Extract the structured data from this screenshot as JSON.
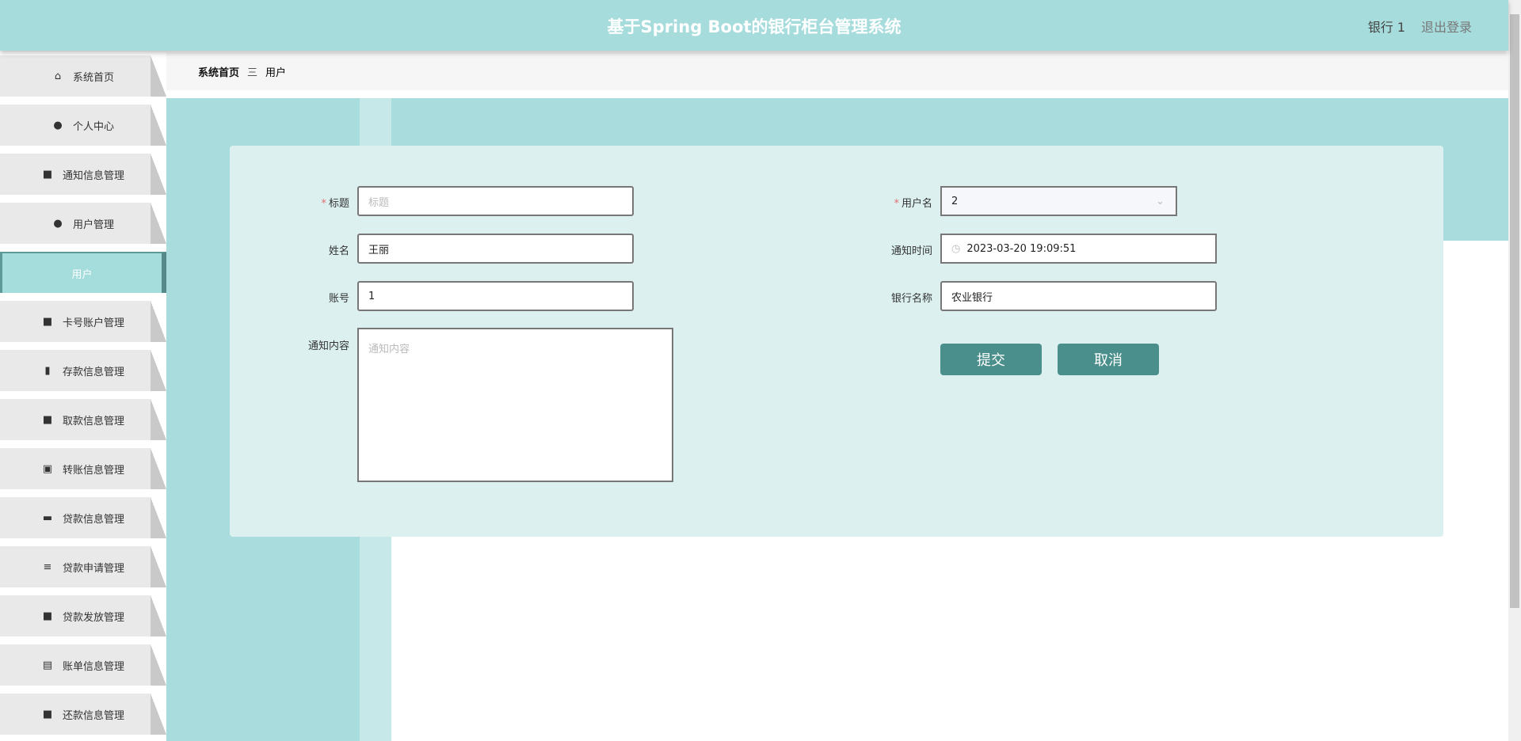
{
  "header": {
    "title": "基于Spring Boot的银行柜台管理系统",
    "user": "银行 1",
    "logout": "退出登录"
  },
  "sidebar": {
    "items": [
      {
        "label": "系统首页",
        "icon": "home-icon"
      },
      {
        "label": "个人中心",
        "icon": "user-icon"
      },
      {
        "label": "通知信息管理",
        "icon": "grid-icon"
      },
      {
        "label": "用户管理",
        "icon": "bulb-icon"
      },
      {
        "label": "用户",
        "icon": "",
        "active": true
      },
      {
        "label": "卡号账户管理",
        "icon": "grid-icon"
      },
      {
        "label": "存款信息管理",
        "icon": "bar-chart-icon"
      },
      {
        "label": "取款信息管理",
        "icon": "grid-icon"
      },
      {
        "label": "转账信息管理",
        "icon": "clipboard-x-icon"
      },
      {
        "label": "贷款信息管理",
        "icon": "briefcase-icon"
      },
      {
        "label": "贷款申请管理",
        "icon": "sliders-icon"
      },
      {
        "label": "贷款发放管理",
        "icon": "grid-icon"
      },
      {
        "label": "账单信息管理",
        "icon": "clipboard-icon"
      },
      {
        "label": "还款信息管理",
        "icon": "grid-icon"
      }
    ]
  },
  "breadcrumb": {
    "home": "系统首页",
    "sep": "三",
    "current": "用户"
  },
  "form": {
    "title": {
      "label": "标题",
      "placeholder": "标题",
      "value": ""
    },
    "name": {
      "label": "姓名",
      "value": "王丽"
    },
    "account": {
      "label": "账号",
      "value": "1"
    },
    "content": {
      "label": "通知内容",
      "placeholder": "通知内容",
      "value": ""
    },
    "username": {
      "label": "用户名",
      "value": "2"
    },
    "time": {
      "label": "通知时间",
      "value": "2023-03-20 19:09:51"
    },
    "bank": {
      "label": "银行名称",
      "value": "农业银行"
    },
    "submit": "提交",
    "cancel": "取消"
  }
}
